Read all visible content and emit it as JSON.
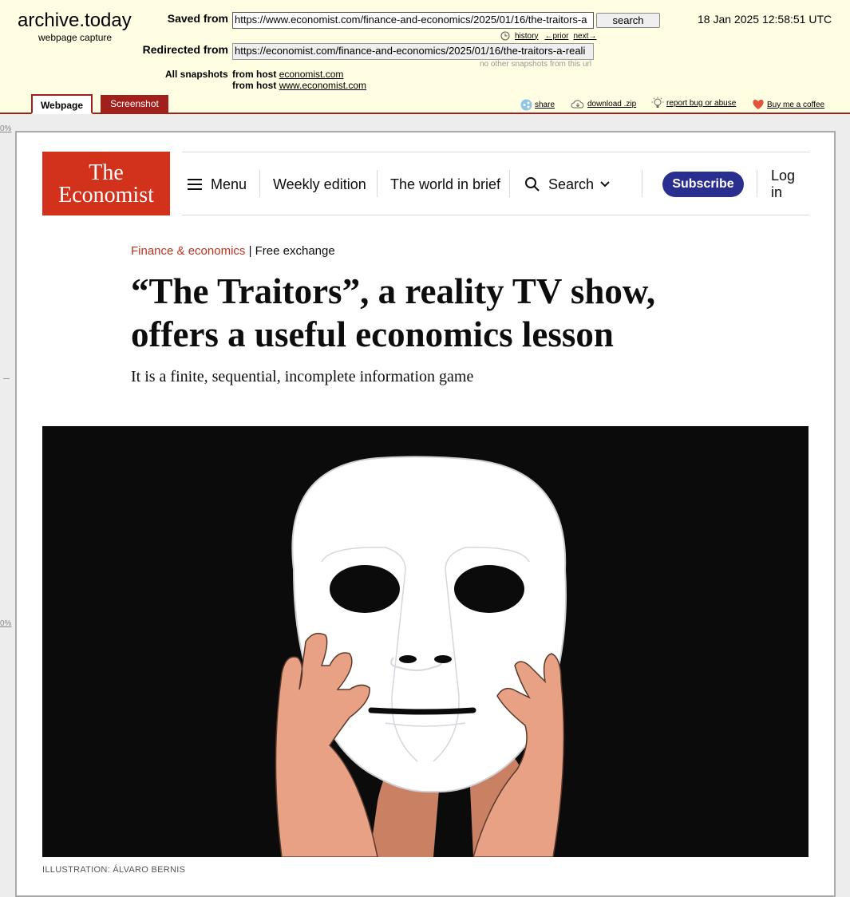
{
  "archive": {
    "logo": "archive.today",
    "logo_sub": "webpage capture",
    "saved_from_label": "Saved from",
    "saved_from_url": "https://www.economist.com/finance-and-economics/2025/01/16/the-traitors-a",
    "search_button": "search",
    "timestamp": "18 Jan 2025 12:58:51 UTC",
    "history_link": "history",
    "prior_link": "←prior",
    "next_link": "next→",
    "redirected_from_label": "Redirected from",
    "redirected_from_url": "https://economist.com/finance-and-economics/2025/01/16/the-traitors-a-reali",
    "no_other_snapshots": "no other snapshots from this url",
    "all_snapshots_label": "All snapshots",
    "from_host_label": "from host",
    "host_1": "economist.com",
    "host_2": "www.economist.com",
    "tabs": {
      "webpage": "Webpage",
      "screenshot": "Screenshot"
    },
    "tools": {
      "share": "share",
      "download": "download .zip",
      "report": "report bug or abuse",
      "coffee": "Buy me a coffee"
    },
    "gutter_label": "0%"
  },
  "economist": {
    "logo_line1": "The",
    "logo_line2": "Economist",
    "nav": {
      "menu": "Menu",
      "weekly": "Weekly edition",
      "world": "The world in brief",
      "search": "Search",
      "subscribe": "Subscribe",
      "login": "Log in"
    },
    "article": {
      "section": "Finance & economics",
      "separator": " | ",
      "column": "Free exchange",
      "headline": "“The Traitors”, a reality TV show, offers a useful economics lesson",
      "standfirst": "It is a finite, sequential, incomplete information game",
      "caption": "ILLUSTRATION: ÁLVARO BERNIS"
    }
  }
}
